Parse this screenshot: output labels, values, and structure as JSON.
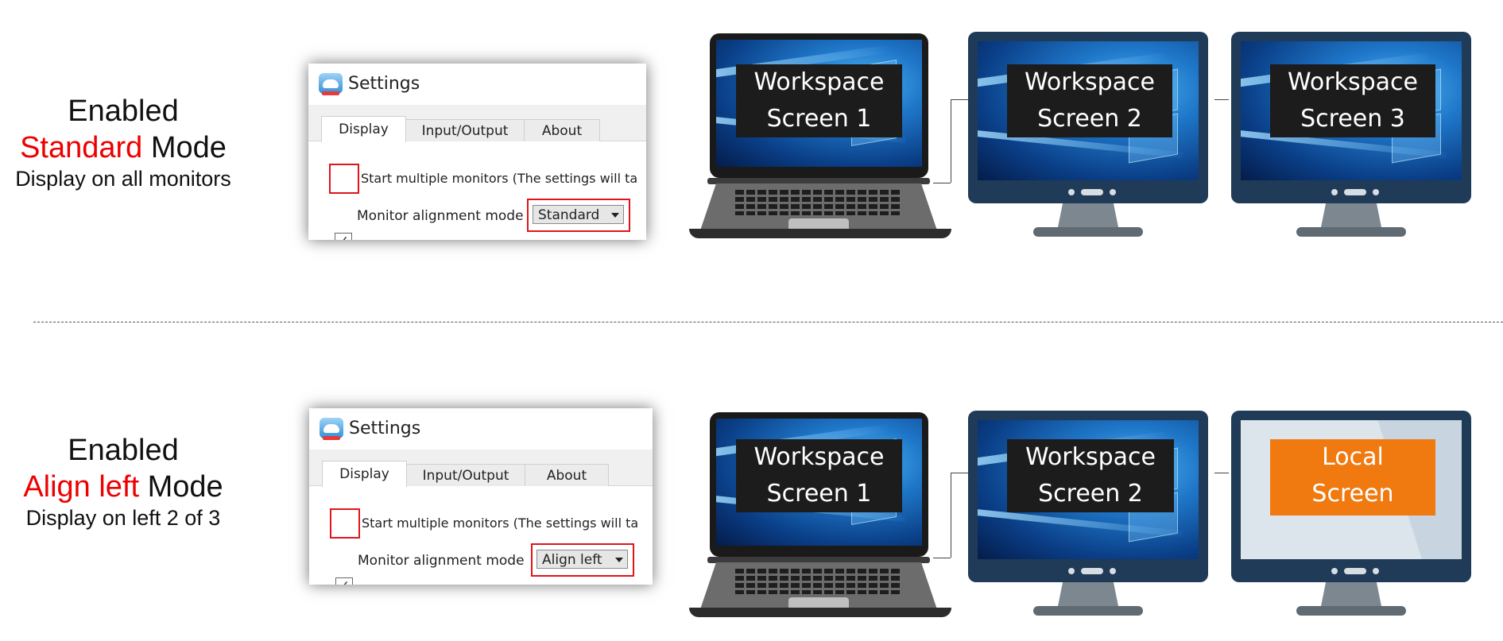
{
  "sections": [
    {
      "mode": {
        "line1": "Enabled",
        "accent": "Standard",
        "line2_rest": " Mode",
        "line3": "Display on all monitors"
      },
      "settings": {
        "title": "Settings",
        "tabs": [
          "Display",
          "Input/Output",
          "About"
        ],
        "checkbox_checked": true,
        "checkbox_label": "Start multiple monitors (The settings will ta",
        "alignment_label": "Monitor alignment mode",
        "alignment_value": "Standard"
      },
      "screens": [
        {
          "device": "laptop",
          "line1": "Workspace",
          "line2": "Screen 1"
        },
        {
          "device": "monitor",
          "line1": "Workspace",
          "line2": "Screen 2"
        },
        {
          "device": "monitor",
          "line1": "Workspace",
          "line2": "Screen 3"
        }
      ]
    },
    {
      "mode": {
        "line1": "Enabled",
        "accent": "Align left",
        "line2_rest": " Mode",
        "line3": "Display on left 2 of 3"
      },
      "settings": {
        "title": "Settings",
        "tabs": [
          "Display",
          "Input/Output",
          "About"
        ],
        "checkbox_checked": true,
        "checkbox_label": "Start multiple monitors (The settings will ta",
        "alignment_label": "Monitor alignment mode",
        "alignment_value": "Align left"
      },
      "screens": [
        {
          "device": "laptop",
          "line1": "Workspace",
          "line2": "Screen 1"
        },
        {
          "device": "monitor",
          "line1": "Workspace",
          "line2": "Screen 2"
        },
        {
          "device": "monitor",
          "line1": "Local",
          "line2": "Screen"
        }
      ]
    }
  ],
  "colors": {
    "accent_text": "#ee0000",
    "highlight_box": "#e0141c",
    "workspace_label_bg": "#1c1c1c",
    "local_label_bg": "#f07a10",
    "monitor_bezel": "#1f3b57"
  },
  "icons": {
    "app": "settings-cloud-icon",
    "checkbox": "checkmark-icon",
    "dropdown": "dropdown-arrow-icon"
  }
}
